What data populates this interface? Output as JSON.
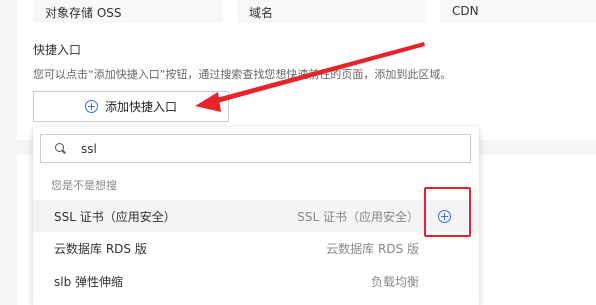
{
  "top_chips": [
    "对象存储 OSS",
    "域名",
    "CDN"
  ],
  "quick_entry": {
    "title": "快捷入口",
    "description": "您可以点击“添加快捷入口”按钮，通过搜索查找您想快速前往的页面，添加到此区域。",
    "add_button_label": "添加快捷入口"
  },
  "dropdown": {
    "search_value": "ssl",
    "suggest_label": "您是不是想搜",
    "results": [
      {
        "name": "SSL 证书（应用安全）",
        "category": "SSL 证书（应用安全）",
        "highlighted": true
      },
      {
        "name": "云数据库 RDS 版",
        "category": "云数据库 RDS 版"
      },
      {
        "name": "slb 弹性伸缩",
        "category": "负载均衡"
      }
    ]
  },
  "colors": {
    "accent": "#3b6fd8",
    "annotation": "#e8242a"
  },
  "icons": [
    "plus-circle-icon",
    "search-icon",
    "add-circle-icon"
  ]
}
